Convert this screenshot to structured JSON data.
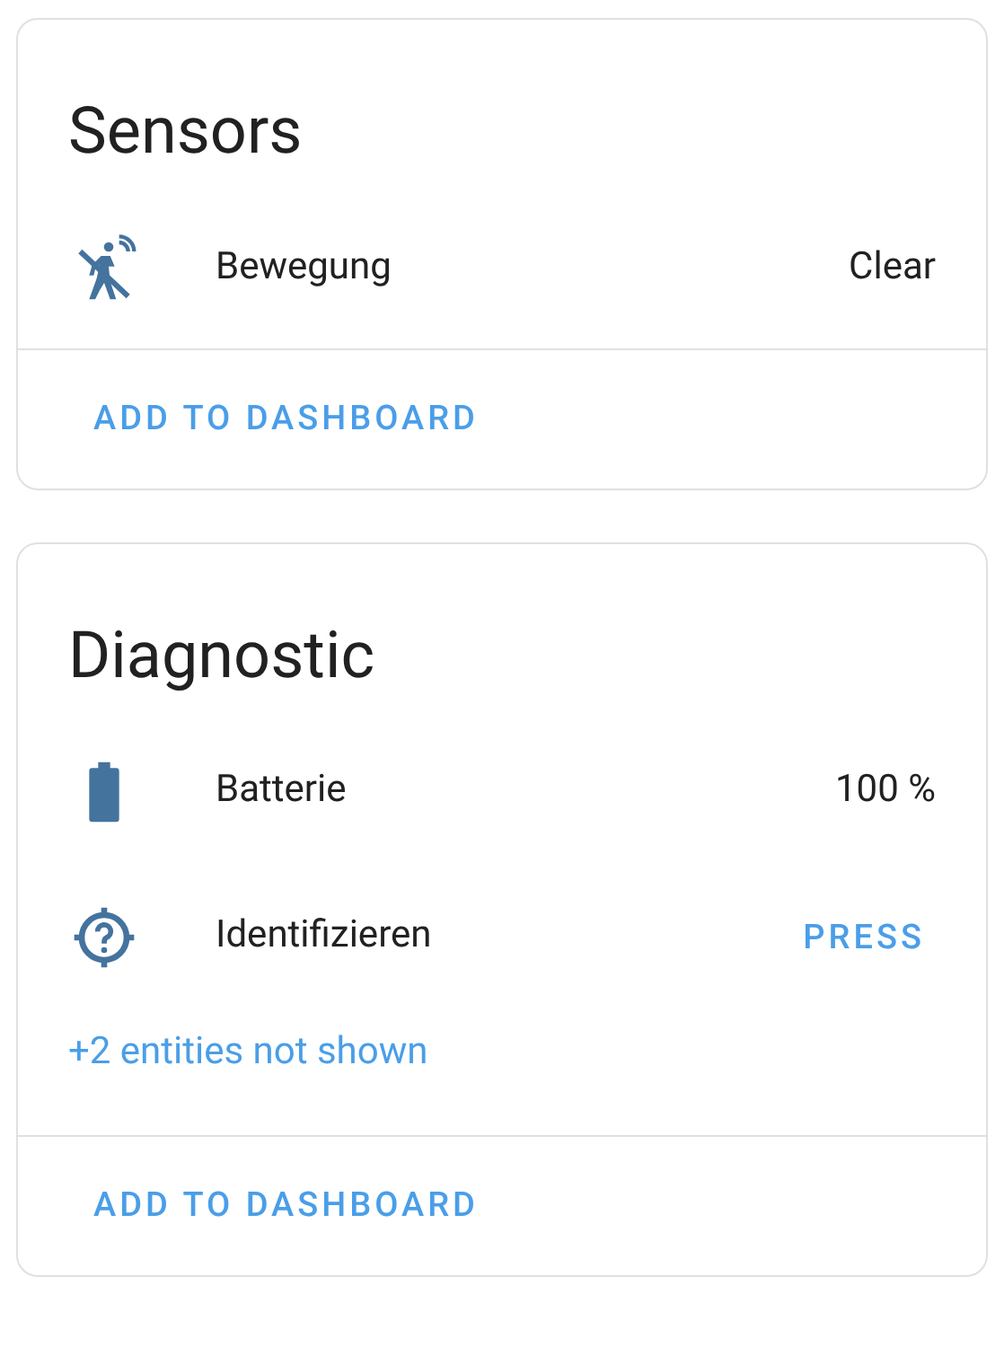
{
  "cards": [
    {
      "title": "Sensors",
      "rows": [
        {
          "kind": "state",
          "name": "Bewegung",
          "value": "Clear"
        }
      ],
      "action": "ADD TO DASHBOARD"
    },
    {
      "title": "Diagnostic",
      "rows": [
        {
          "kind": "state",
          "name": "Batterie",
          "value": "100 %"
        },
        {
          "kind": "button",
          "name": "Identifizieren",
          "value": "PRESS"
        }
      ],
      "more": "+2 entities not shown",
      "action": "ADD TO DASHBOARD"
    }
  ]
}
